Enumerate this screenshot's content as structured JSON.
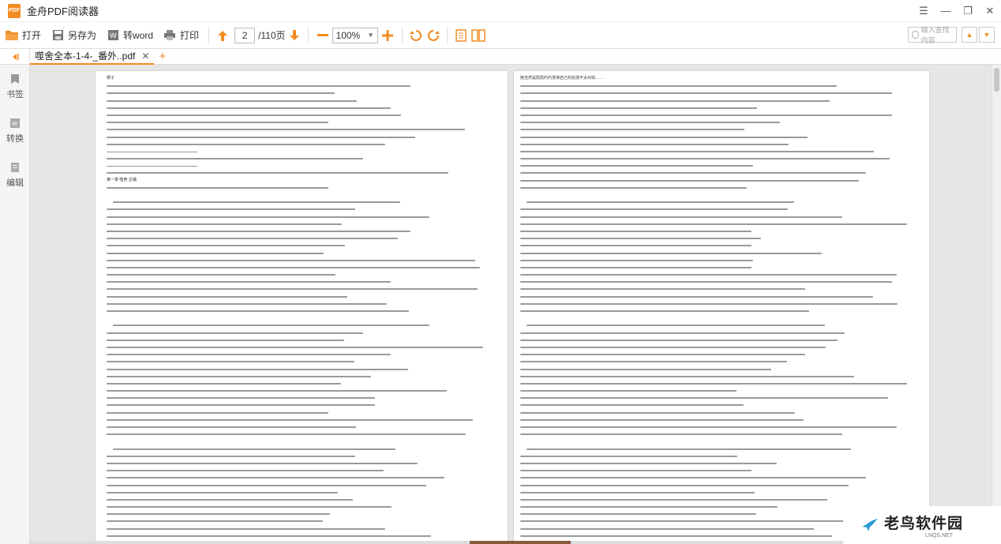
{
  "app": {
    "logo_text": "PDF",
    "title": "金舟PDF阅读器",
    "window_controls": [
      "☰",
      "—",
      "❐",
      "✕"
    ]
  },
  "toolbar": {
    "open_label": "打开",
    "save_as_label": "另存为",
    "convert_word_label": "转word",
    "print_label": "打印",
    "current_page": "2",
    "total_pages": "/110页",
    "zoom": "100%",
    "search_placeholder": "输入查找内容"
  },
  "tabs": {
    "active_tab": "噬舍全本-1-4-_番外..pdf",
    "close_glyph": "✕",
    "add_glyph": "+"
  },
  "sidebar": {
    "items": [
      {
        "label": "书签",
        "icon": "bookmark-icon"
      },
      {
        "label": "转换",
        "icon": "convert-icon"
      },
      {
        "label": "编辑",
        "icon": "edit-icon"
      }
    ]
  },
  "pages": {
    "left_snippets": [
      "楔子",
      "第一章 噬舍·古镇"
    ],
    "right_snippets": [
      "她当然是隐隐约约觉得自己的处境不太对劲……"
    ]
  },
  "watermark": {
    "title": "老鸟软件园",
    "subtitle": "LNQS.NET"
  },
  "colors": {
    "accent": "#f28b22",
    "page_bg": "#ffffff",
    "viewer_bg": "#e6e6e6"
  }
}
